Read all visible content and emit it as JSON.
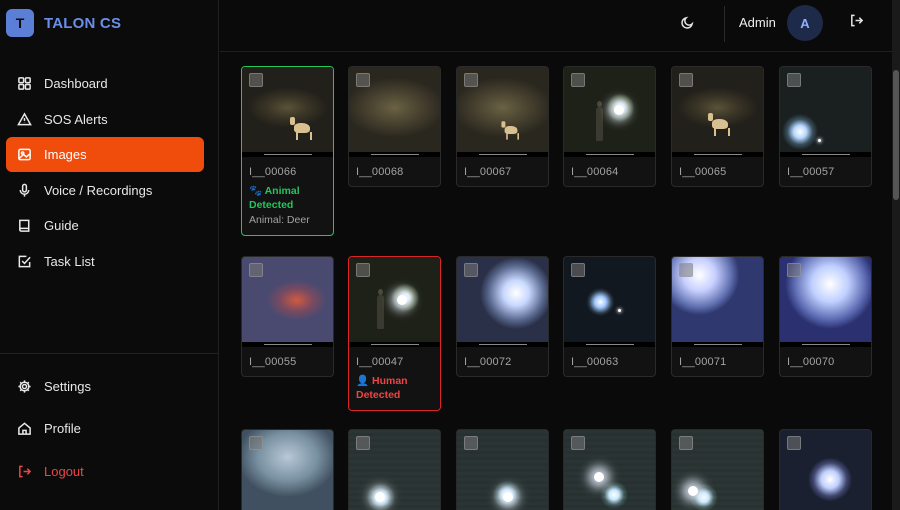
{
  "brand": {
    "logo_letter": "T",
    "name": "TALON CS"
  },
  "nav": [
    {
      "label": "Dashboard",
      "icon": "grid-icon",
      "active": false
    },
    {
      "label": "SOS Alerts",
      "icon": "warning-icon",
      "active": false
    },
    {
      "label": "Images",
      "icon": "image-icon",
      "active": true
    },
    {
      "label": "Voice / Recordings",
      "icon": "mic-icon",
      "active": false
    },
    {
      "label": "Guide",
      "icon": "book-icon",
      "active": false
    },
    {
      "label": "Task List",
      "icon": "checkbox-icon",
      "active": false
    }
  ],
  "bottom_nav": [
    {
      "label": "Settings",
      "icon": "gear-icon"
    },
    {
      "label": "Profile",
      "icon": "home-icon"
    },
    {
      "label": "Logout",
      "icon": "logout-icon"
    }
  ],
  "header": {
    "user_name": "Admin",
    "avatar_letter": "A"
  },
  "colors": {
    "accent": "#f04d0c",
    "brand": "#6b8fe8",
    "animal": "#22c55e",
    "human": "#ef4444"
  },
  "images": [
    {
      "name": "I__00066",
      "detection": "animal",
      "tag": "🐾 Animal Detected",
      "sub": "Animal: Deer"
    },
    {
      "name": "I__00068"
    },
    {
      "name": "I__00067"
    },
    {
      "name": "I__00064"
    },
    {
      "name": "I__00065"
    },
    {
      "name": "I__00057"
    },
    {
      "name": "I__00055"
    },
    {
      "name": "I__00047",
      "detection": "human",
      "tag": "👤 Human Detected"
    },
    {
      "name": "I__00072"
    },
    {
      "name": "I__00063"
    },
    {
      "name": "I__00071"
    },
    {
      "name": "I__00070"
    }
  ]
}
